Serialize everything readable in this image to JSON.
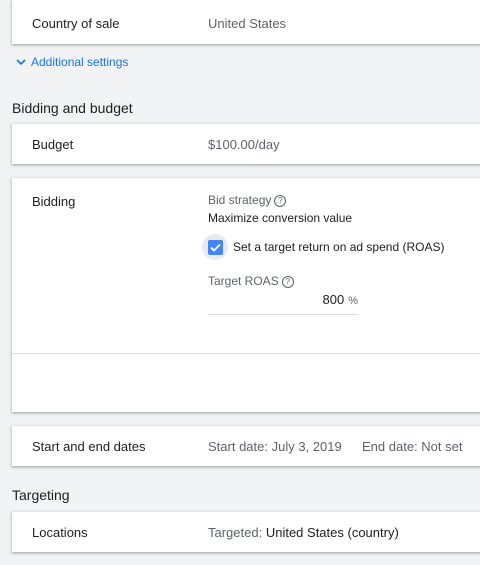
{
  "general": {
    "country_label": "Country of sale",
    "country_value": "United States",
    "additional_settings": "Additional settings"
  },
  "bidding_budget": {
    "section_title": "Bidding and budget",
    "budget_label": "Budget",
    "budget_value": "$100.00/day",
    "bidding_label": "Bidding",
    "bid_strategy_label": "Bid strategy",
    "bid_strategy_value": "Maximize conversion value",
    "target_roas_checkbox_label": "Set a target return on ad spend (ROAS)",
    "target_roas_checked": true,
    "target_roas_label": "Target ROAS",
    "target_roas_value": "800",
    "target_roas_unit": "%",
    "dates_label": "Start and end dates",
    "start_date": "Start date: July 3, 2019",
    "end_date": "End date: Not set"
  },
  "targeting": {
    "section_title": "Targeting",
    "locations_label": "Locations",
    "locations_prefix": "Targeted:",
    "locations_value": "United States (country)"
  },
  "colors": {
    "accent": "#1a73e8",
    "checkbox": "#4285f4",
    "background": "#f1f3f4"
  }
}
